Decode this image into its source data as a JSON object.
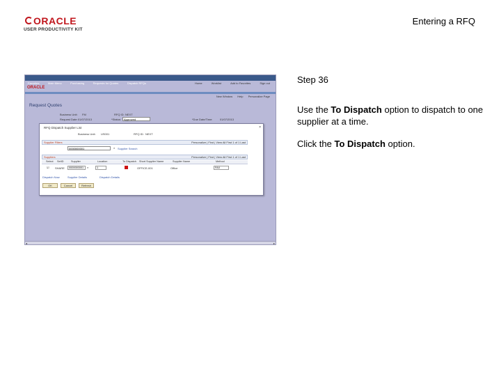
{
  "logo": {
    "brand": "ORACLE",
    "sub": "USER PRODUCTIVITY KIT"
  },
  "header": {
    "title": "Entering a RFQ"
  },
  "screenshot": {
    "menu": [
      "Favorites",
      "Main Menu",
      "Purchasing",
      "Requests for Quotes",
      "Dispatch RFQs"
    ],
    "top_links": [
      "Home",
      "Worklist",
      "Add to Favorites",
      "Sign out"
    ],
    "oracle": "ORACLE",
    "toolinks": [
      "New Window",
      "Help",
      "Personalize Page"
    ],
    "page_title": "Request Quotes",
    "fields": {
      "unit_label": "Business Unit:",
      "unit_value": "FM",
      "rfq_label": "RFQ ID:",
      "rfq_value": "NEXT",
      "date_label": "Request Date:",
      "date_value": "01/07/2013",
      "status_label": "*Status:",
      "status_value": "Approved",
      "due_label": "*Due Date/Time:",
      "due_value": "01/07/2013"
    },
    "dialog": {
      "title": "RFQ Dispatch Supplier List",
      "close": "×",
      "unit_label": "Business Unit:",
      "unit_value": "US001",
      "rfq_label": "RFQ ID:",
      "rfq_value": "NEXT",
      "suppliers_top": "Supplier Filters",
      "nav_top": "Personalize | Find | View All  First 1 of 1 Last",
      "supplier_link": "Supplier Search",
      "suppliers_hdr": "Suppliers",
      "nav2": "Personalize | Find | View All  First 1 of 1 Last",
      "cols": [
        "Select",
        "SetID",
        "Supplier",
        "Location",
        "To Dispatch",
        "Short Supplier Name",
        "Supplier Name",
        "Method"
      ],
      "row": {
        "setid": "SHARE",
        "supplier": "0000000001",
        "location": "1",
        "short_name": "OFFICE-001",
        "name": "Office",
        "method": "FAX"
      },
      "links": [
        "Dispatch Now",
        "Supplier Details",
        "Dispatch Details"
      ],
      "buttons": [
        "OK",
        "Cancel",
        "Refresh"
      ]
    },
    "scroll_left": "◂",
    "scroll_right": "▸"
  },
  "instructions": {
    "step": "Step 36",
    "line1_pre": "Use the ",
    "line1_bold": "To Dispatch",
    "line1_post": " option to dispatch to one supplier at a time.",
    "line2_pre": "Click the ",
    "line2_bold": "To Dispatch",
    "line2_post": " option."
  }
}
